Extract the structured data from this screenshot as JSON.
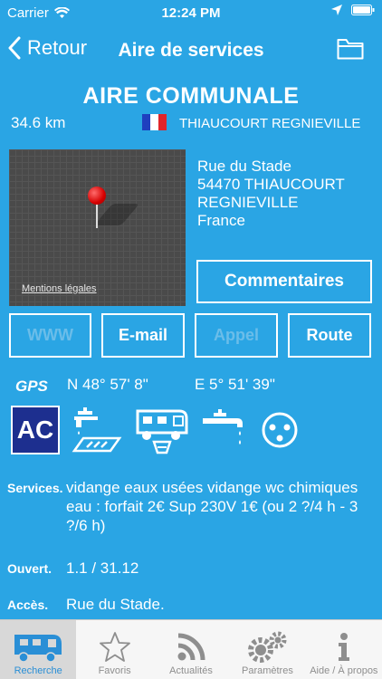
{
  "status": {
    "carrier": "Carrier",
    "time": "12:24 PM"
  },
  "nav": {
    "back_label": "Retour",
    "title": "Aire de services"
  },
  "place": {
    "name": "AIRE COMMUNALE",
    "distance": "34.6 km",
    "city": "THIAUCOURT REGNIEVILLE",
    "address": [
      "Rue du Stade",
      "54470 THIAUCOURT",
      "REGNIEVILLE",
      "France"
    ]
  },
  "map": {
    "legal": "Mentions légales"
  },
  "buttons": {
    "comments": "Commentaires",
    "www": "WWW",
    "email": "E-mail",
    "appel": "Appel",
    "route": "Route"
  },
  "gps": {
    "label": "GPS",
    "lat": "N 48° 57'  8\"",
    "lon": "E  5° 51' 39\""
  },
  "amenities": {
    "ac": "AC",
    "icons": [
      "water-tap-icon",
      "motorhome-drain-icon",
      "water-outlet-icon",
      "power-socket-icon"
    ]
  },
  "details": {
    "services_label": "Services.",
    "services_value": "vidange eaux usées vidange wc chimiques eau : forfait 2€ Sup 230V 1€ (ou 2 ?/4 h - 3 ?/6 h)",
    "open_label": "Ouvert.",
    "open_value": "1.1 / 31.12",
    "access_label": "Accès.",
    "access_value": "Rue du Stade."
  },
  "tabs": [
    {
      "label": "Recherche",
      "icon": "motorhome-icon",
      "active": true
    },
    {
      "label": "Favoris",
      "icon": "star-icon"
    },
    {
      "label": "Actualités",
      "icon": "rss-icon"
    },
    {
      "label": "Paramètres",
      "icon": "gears-icon"
    },
    {
      "label": "Aide / À propos",
      "icon": "info-icon"
    }
  ],
  "colors": {
    "background": "#2aa5e4",
    "ac_badge": "#1d2f8f",
    "tab_active": "#2a8fd6"
  }
}
